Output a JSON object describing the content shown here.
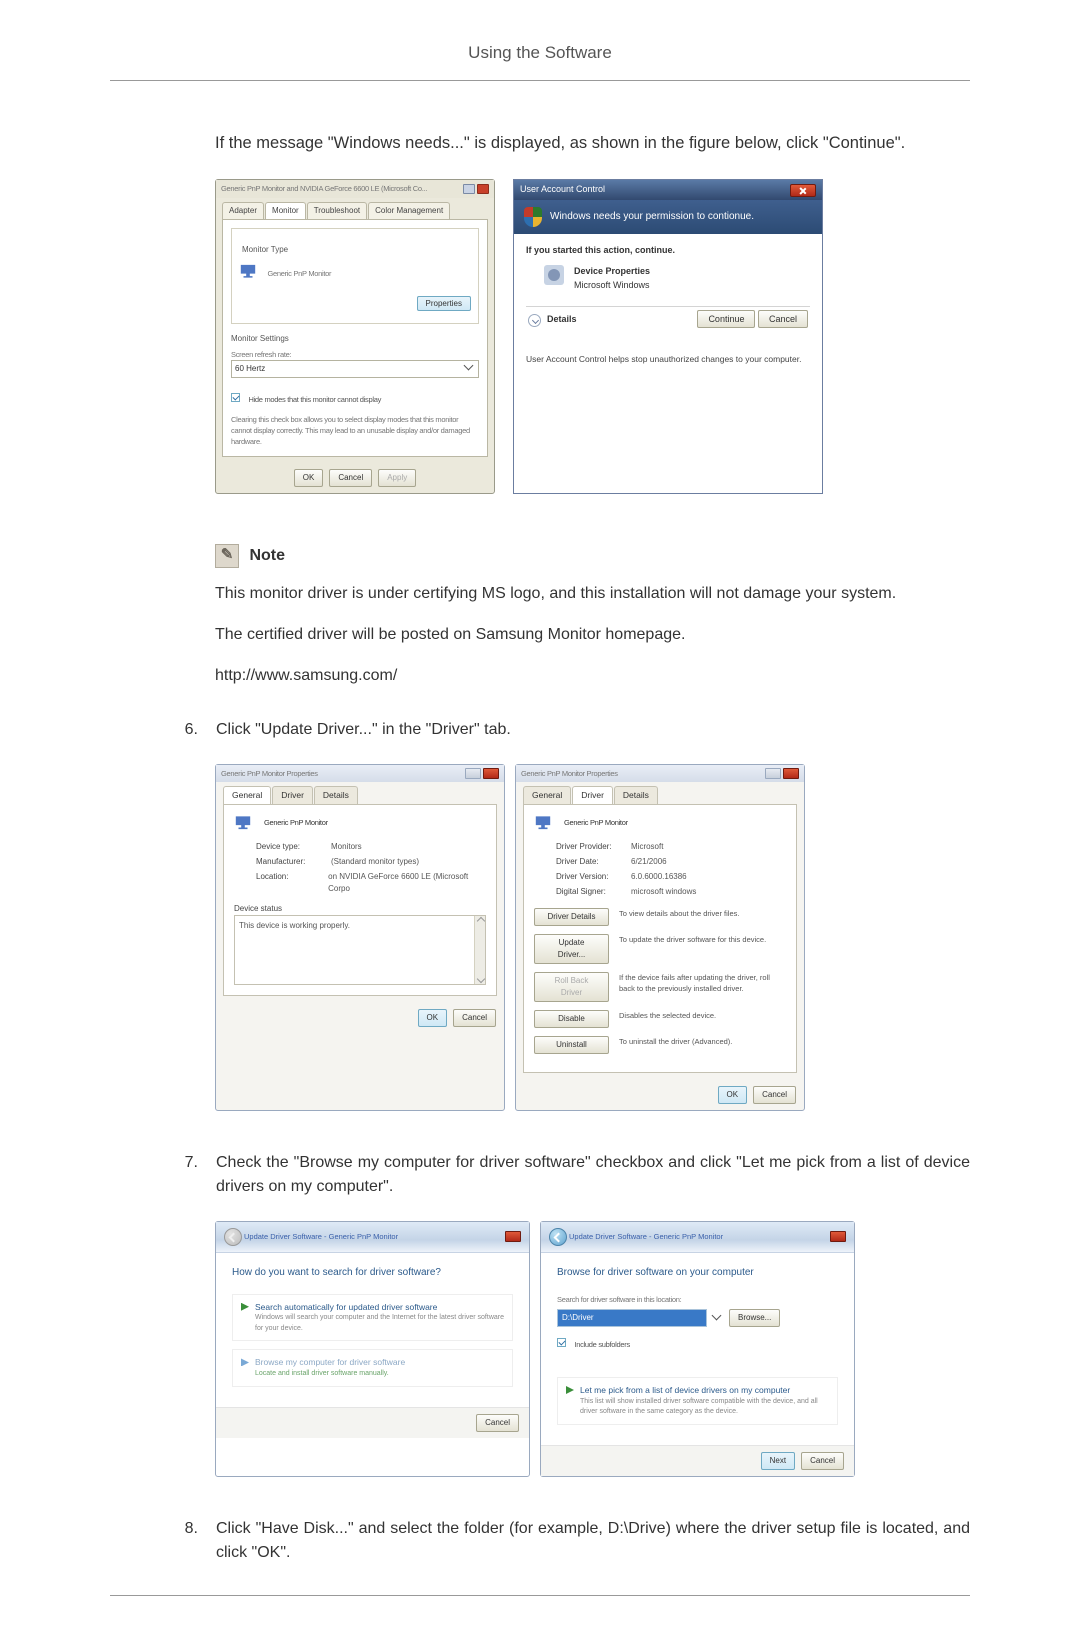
{
  "page_header": "Using the Software",
  "intro": "If the message \"Windows needs...\" is displayed, as shown in the figure below, click \"Continue\".",
  "monitor_dialog": {
    "title": "Generic PnP Monitor and NVIDIA GeForce 6600 LE (Microsoft Co...",
    "tabs": [
      "Adapter",
      "Monitor",
      "Troubleshoot",
      "Color Management"
    ],
    "monitor_type_label": "Monitor Type",
    "monitor_name": "Generic PnP Monitor",
    "properties_btn": "Properties",
    "settings_label": "Monitor Settings",
    "refresh_label": "Screen refresh rate:",
    "refresh_value": "60 Hertz",
    "hide_modes": "Hide modes that this monitor cannot display",
    "hide_modes_desc": "Clearing this check box allows you to select display modes that this monitor cannot display correctly. This may lead to an unusable display and/or damaged hardware.",
    "ok": "OK",
    "cancel": "Cancel",
    "apply": "Apply"
  },
  "uac_dialog": {
    "title": "User Account Control",
    "banner": "Windows needs your permission to contionue.",
    "started": "If you started this action, continue.",
    "program_name": "Device Properties",
    "program_publisher": "Microsoft Windows",
    "details": "Details",
    "continue": "Continue",
    "cancel": "Cancel",
    "footer": "User Account Control helps stop unauthorized changes to your computer."
  },
  "note": {
    "heading": "Note",
    "line1": "This monitor driver is under certifying MS logo, and this installation will not damage your system.",
    "line2": "The certified driver will be posted on Samsung Monitor homepage.",
    "url": "http://www.samsung.com/"
  },
  "step6": {
    "num": "6.",
    "text": "Click \"Update Driver...\" in the \"Driver\" tab."
  },
  "props_general": {
    "title": "Generic PnP Monitor Properties",
    "tabs": [
      "General",
      "Driver",
      "Details"
    ],
    "name": "Generic PnP Monitor",
    "device_type_k": "Device type:",
    "device_type_v": "Monitors",
    "manufacturer_k": "Manufacturer:",
    "manufacturer_v": "(Standard monitor types)",
    "location_k": "Location:",
    "location_v": "on NVIDIA GeForce 6600 LE (Microsoft Corpo",
    "status_label": "Device status",
    "status_text": "This device is working properly.",
    "ok": "OK",
    "cancel": "Cancel"
  },
  "props_driver": {
    "title": "Generic PnP Monitor Properties",
    "tabs": [
      "General",
      "Driver",
      "Details"
    ],
    "name": "Generic PnP Monitor",
    "provider_k": "Driver Provider:",
    "provider_v": "Microsoft",
    "date_k": "Driver Date:",
    "date_v": "6/21/2006",
    "version_k": "Driver Version:",
    "version_v": "6.0.6000.16386",
    "signer_k": "Digital Signer:",
    "signer_v": "microsoft windows",
    "btn_details": "Driver Details",
    "desc_details": "To view details about the driver files.",
    "btn_update": "Update Driver...",
    "desc_update": "To update the driver software for this device.",
    "btn_rollback": "Roll Back Driver",
    "desc_rollback": "If the device fails after updating the driver, roll back to the previously installed driver.",
    "btn_disable": "Disable",
    "desc_disable": "Disables the selected device.",
    "btn_uninstall": "Uninstall",
    "desc_uninstall": "To uninstall the driver (Advanced).",
    "ok": "OK",
    "cancel": "Cancel"
  },
  "step7": {
    "num": "7.",
    "text": "Check the \"Browse my computer for driver software\" checkbox and click \"Let me pick from a list of device drivers on my computer\"."
  },
  "wiz_a": {
    "title": "Update Driver Software - Generic PnP Monitor",
    "heading": "How do you want to search for driver software?",
    "opt1_title": "Search automatically for updated driver software",
    "opt1_desc": "Windows will search your computer and the Internet for the latest driver software for your device.",
    "opt2_title": "Browse my computer for driver software",
    "opt2_desc": "Locate and install driver software manually.",
    "cancel": "Cancel"
  },
  "wiz_b": {
    "title": "Update Driver Software - Generic PnP Monitor",
    "heading": "Browse for driver software on your computer",
    "search_label": "Search for driver software in this location:",
    "path_value": "D:\\Driver",
    "browse": "Browse...",
    "include_sub": "Include subfolders",
    "opt_title": "Let me pick from a list of device drivers on my computer",
    "opt_desc": "This list will show installed driver software compatible with the device, and all driver software in the same category as the device.",
    "next": "Next",
    "cancel": "Cancel"
  },
  "step8": {
    "num": "8.",
    "text": "Click \"Have Disk...\" and select the folder (for example, D:\\Drive) where the driver setup file is located, and click \"OK\"."
  }
}
